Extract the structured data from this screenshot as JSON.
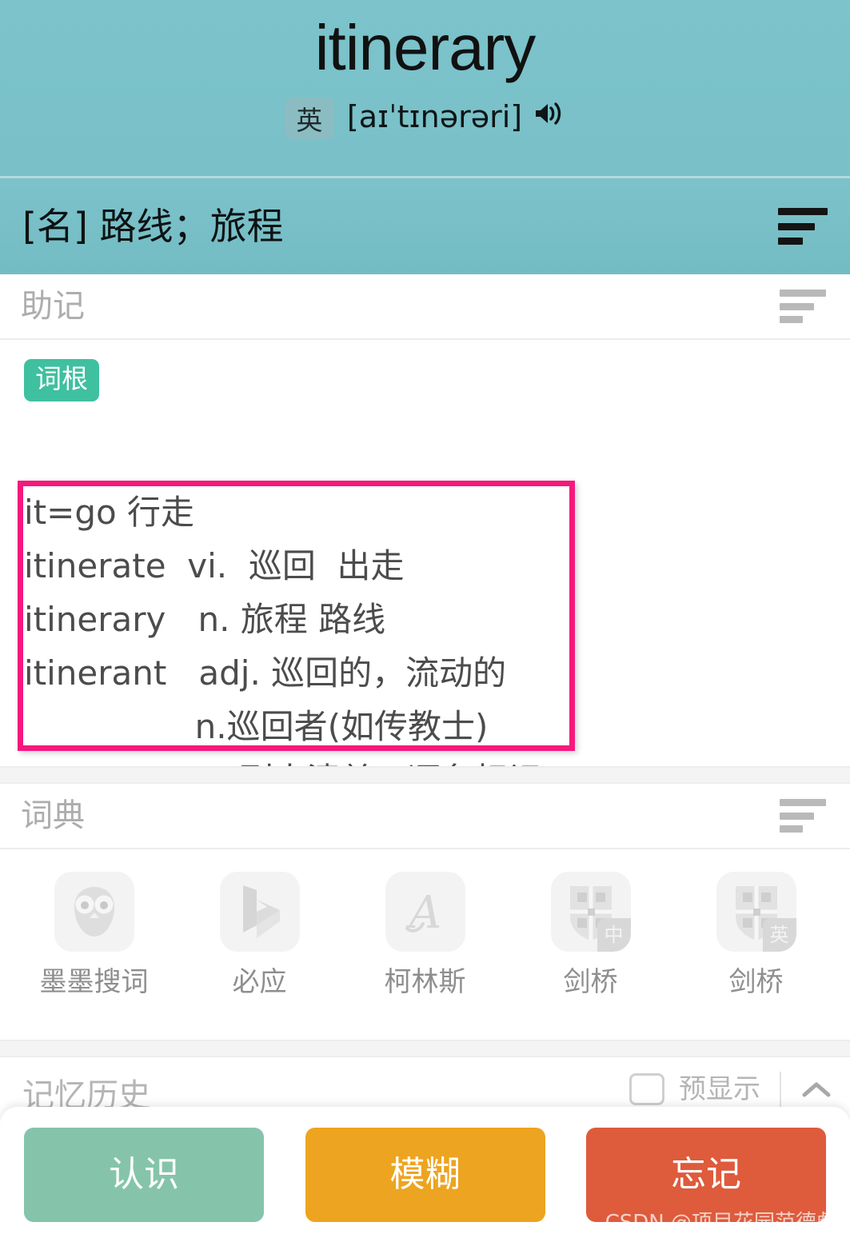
{
  "header": {
    "word": "itinerary",
    "lang_badge": "英",
    "phonetic": "[aɪˈtɪnərəri]",
    "speaker_icon": "speaker-icon",
    "definition": "[名] 路线；旅程",
    "sort_icon": "sort-lines-icon",
    "bg_color": "#78c0c8"
  },
  "mnemonic": {
    "section_title": "助记",
    "sort_icon": "sort-lines-icon",
    "tag": "词根",
    "tag_color": "#3fc0a0",
    "highlight_color": "#f6197d",
    "lines": [
      "it=go 行走",
      "itinerate  vi.  巡回  出走",
      "itinerary   n. 旅程 路线",
      "itinerant   adj. 巡回的，流动的",
      "                n.巡回者(如传教士)",
      "itemize     v. 列出清单，逐条标记"
    ],
    "highlighted_line_start": 0,
    "highlighted_line_end": 4
  },
  "dictionary": {
    "section_title": "词典",
    "sort_icon": "sort-lines-icon",
    "items": [
      {
        "label": "墨墨搜词",
        "icon": "owl-icon",
        "badge": ""
      },
      {
        "label": "必应",
        "icon": "bing-logo-icon",
        "badge": ""
      },
      {
        "label": "柯林斯",
        "icon": "collins-script-a-icon",
        "badge": ""
      },
      {
        "label": "剑桥",
        "icon": "cambridge-shield-icon",
        "badge": "中"
      },
      {
        "label": "剑桥",
        "icon": "cambridge-shield-icon",
        "badge": "英"
      }
    ]
  },
  "history": {
    "section_title": "记忆历史",
    "checkbox_label": "预显示",
    "checkbox_icon": "checkbox-unchecked-icon",
    "collapse_icon": "chevron-up-icon"
  },
  "actions": {
    "buttons": [
      {
        "label": "认识",
        "color": "#85c4ab"
      },
      {
        "label": "模糊",
        "color": "#eda420"
      },
      {
        "label": "忘记",
        "color": "#de5b3c"
      }
    ]
  },
  "watermark": "CSDN @项目花园范德彪"
}
